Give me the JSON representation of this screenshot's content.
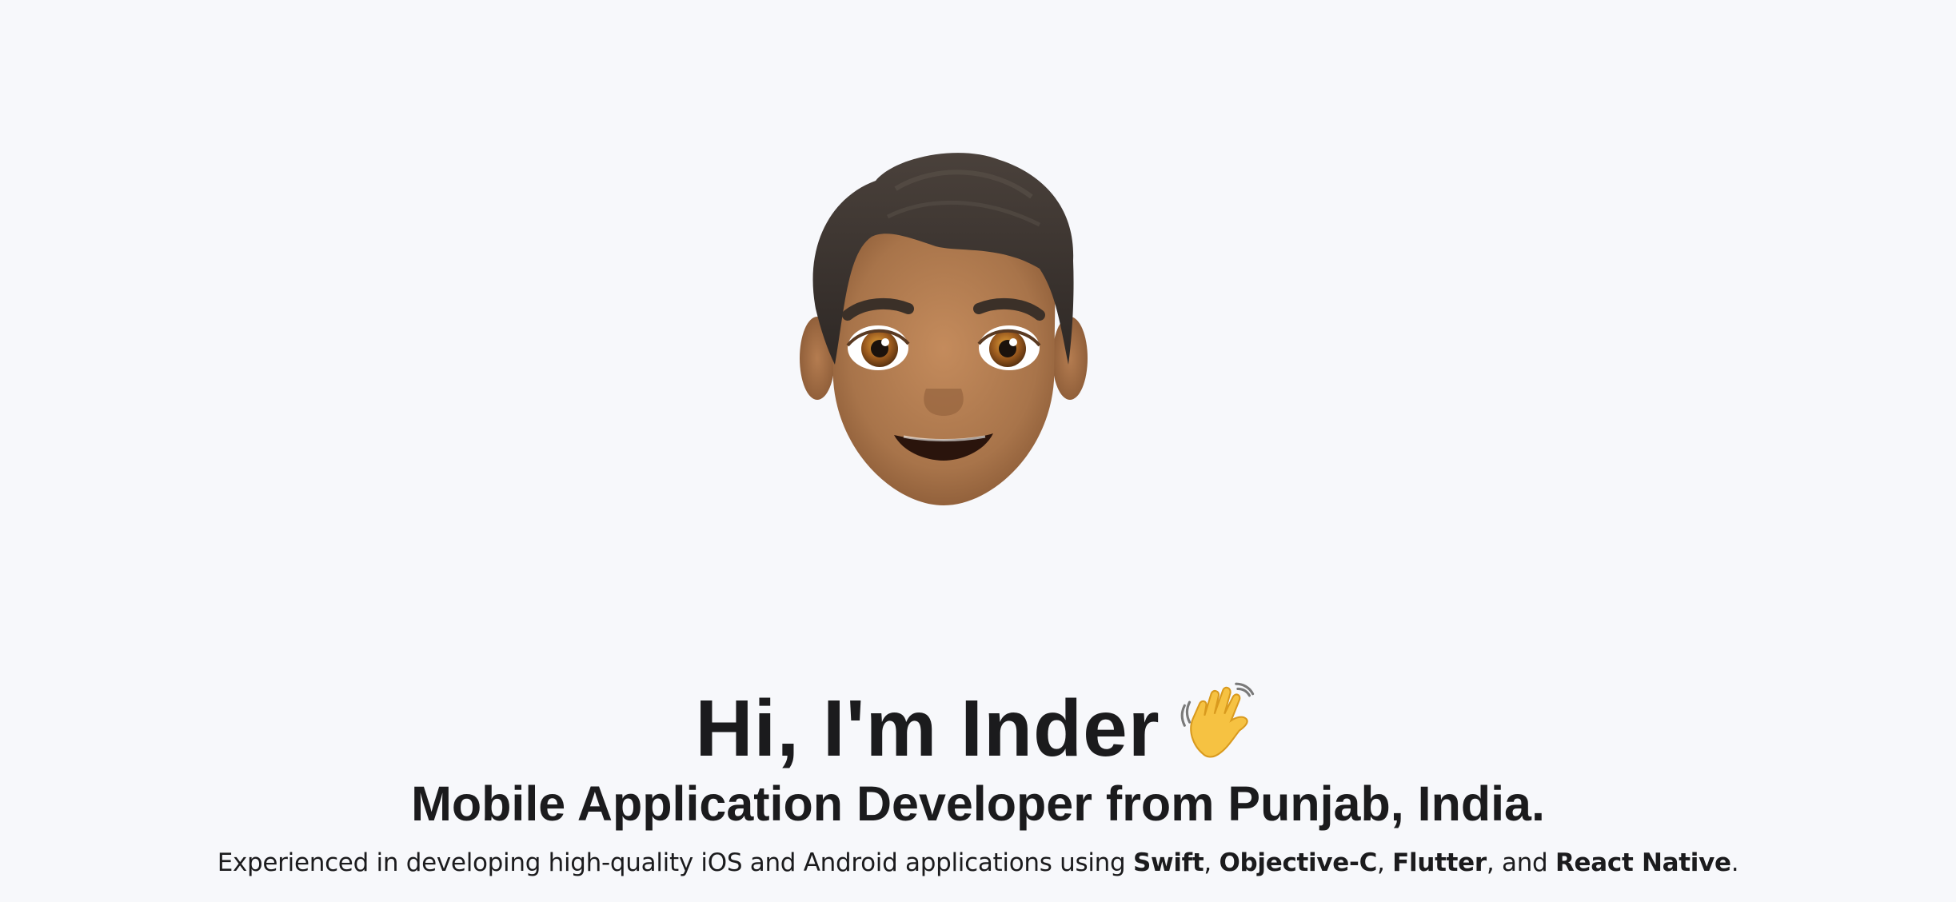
{
  "hero": {
    "avatar_icon": "memoji-avatar-icon",
    "greeting": "Hi, I'm Inder",
    "greeting_icon": "waving-hand-icon",
    "tagline": "Mobile Application Developer from Punjab, India.",
    "description": {
      "prefix": "Experienced in developing high-quality iOS and Android applications using ",
      "tech_1": "Swift",
      "sep_1": ", ",
      "tech_2": "Objective-C",
      "sep_2": ", ",
      "tech_3": "Flutter",
      "sep_3": ", and ",
      "tech_4": "React Native",
      "suffix": "."
    }
  },
  "colors": {
    "background": "#f7f8fb",
    "text": "#1b1b1d",
    "skin": "#b07a4f",
    "hair": "#3b3430",
    "wave_hand": "#f6c242"
  }
}
